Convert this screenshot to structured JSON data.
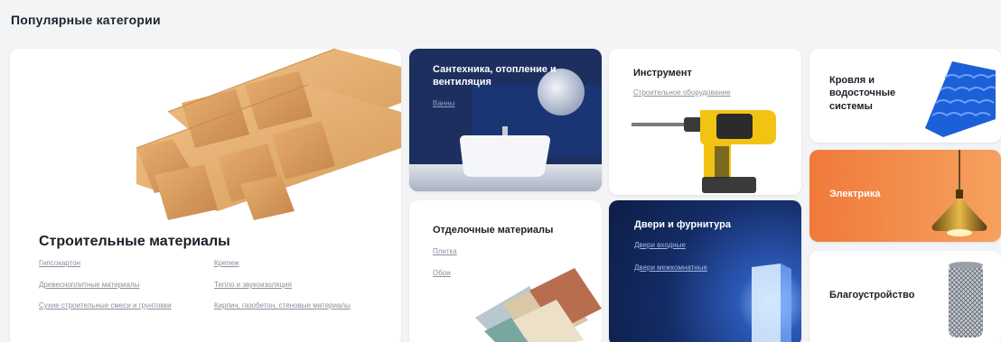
{
  "section": {
    "title": "Популярные категории"
  },
  "cards": {
    "building": {
      "title": "Строительные материалы",
      "links": [
        "Гипсокартон",
        "Крепеж",
        "Древесноплитные материалы",
        "Тепло и звукоизоляция",
        "Сухие строительные смеси и грунтовки",
        "Кирпич, газобетон, стеновые материалы"
      ]
    },
    "plumbing": {
      "title": "Сантехника, отопление и вентиляция",
      "links": [
        "Ванны"
      ]
    },
    "tools": {
      "title": "Инструмент",
      "links": [
        "Строительное оборудование"
      ]
    },
    "roof": {
      "title": "Кровля и водосточные системы"
    },
    "electric": {
      "title": "Электрика"
    },
    "finishing": {
      "title": "Отделочные материалы",
      "links": [
        "Плитка",
        "Обои"
      ]
    },
    "doors": {
      "title": "Двери и фурнитура",
      "links": [
        "Двери входные",
        "Двери межкомнатные"
      ]
    },
    "landscape": {
      "title": "Благоустройство"
    }
  },
  "colors": {
    "plumbing_bg": "#1c2f5e",
    "electric_bg": "#f07a3a",
    "doors_bg": "#142c66"
  }
}
